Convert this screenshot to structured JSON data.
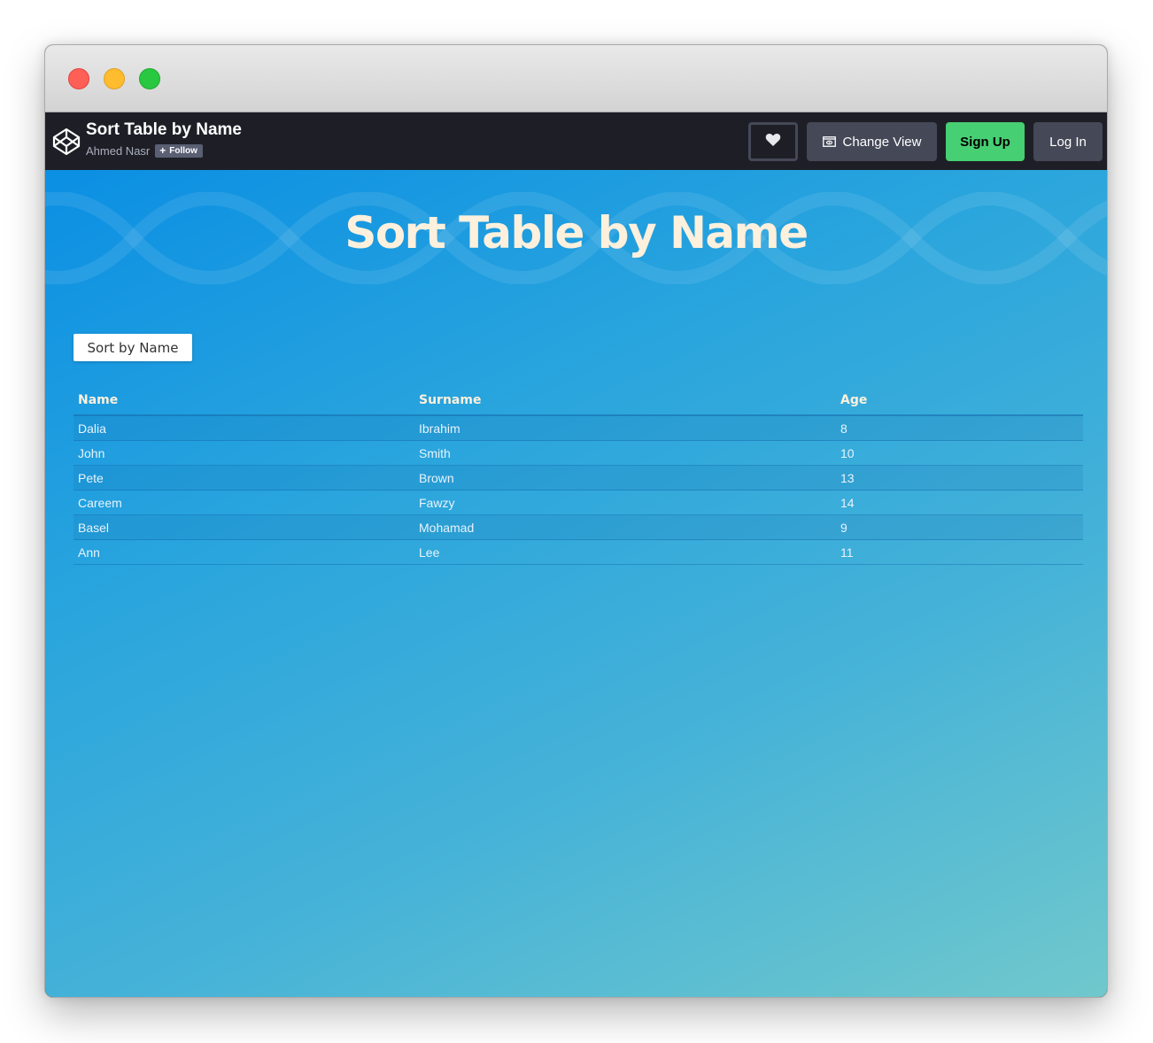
{
  "window": {
    "controls": [
      "close",
      "minimize",
      "zoom"
    ]
  },
  "header": {
    "title": "Sort Table by Name",
    "author": "Ahmed Nasr",
    "follow_label": "Follow",
    "change_view_label": "Change View",
    "signup_label": "Sign Up",
    "login_label": "Log In",
    "icons": {
      "logo": "codepen-logo-icon",
      "heart": "heart-icon",
      "change_view": "change-view-icon"
    }
  },
  "preview": {
    "heading": "Sort Table by Name",
    "sort_button_label": "Sort by Name",
    "table": {
      "columns": [
        "Name",
        "Surname",
        "Age"
      ],
      "rows": [
        [
          "Dalia",
          "Ibrahim",
          "8"
        ],
        [
          "John",
          "Smith",
          "10"
        ],
        [
          "Pete",
          "Brown",
          "13"
        ],
        [
          "Careem",
          "Fawzy",
          "14"
        ],
        [
          "Basel",
          "Mohamad",
          "9"
        ],
        [
          "Ann",
          "Lee",
          "11"
        ]
      ]
    }
  },
  "colors": {
    "signup": "#47cf73",
    "header_bg": "#1e1f26",
    "button_bg": "#444857",
    "heading_text": "#fdf0dc",
    "preview_top": "#0b8fe3",
    "preview_bottom": "#70c8cc"
  }
}
